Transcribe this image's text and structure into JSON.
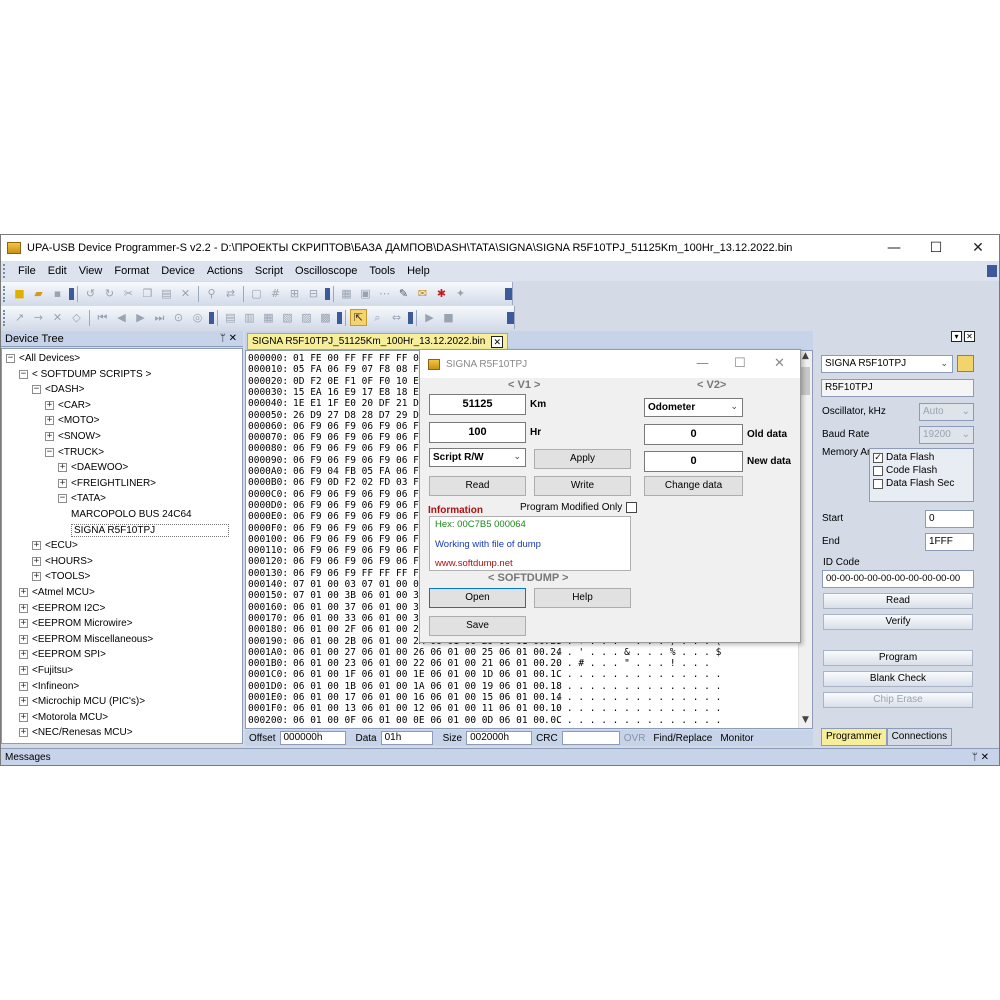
{
  "window": {
    "title": "UPA-USB Device Programmer-S v2.2 - D:\\ПРОЕКТЫ СКРИПТОВ\\БАЗА ДАМПОВ\\DASH\\TATA\\SIGNA\\SIGNA R5F10TPJ_51125Km_100Hr_13.12.2022.bin",
    "minimize": "—",
    "maximize": "☐",
    "close": "✕"
  },
  "menu": [
    "File",
    "Edit",
    "View",
    "Format",
    "Device",
    "Actions",
    "Script",
    "Oscilloscope",
    "Tools",
    "Help"
  ],
  "device_tree": {
    "header": "Device Tree",
    "pin": "ᛘ ✕",
    "items": [
      {
        "label": "<All Devices>",
        "level": 0,
        "exp": "−"
      },
      {
        "label": "< SOFTDUMP SCRIPTS >",
        "level": 1,
        "exp": "−"
      },
      {
        "label": "<DASH>",
        "level": 2,
        "exp": "−"
      },
      {
        "label": "<CAR>",
        "level": 3,
        "exp": "+"
      },
      {
        "label": "<MOTO>",
        "level": 3,
        "exp": "+"
      },
      {
        "label": "<SNOW>",
        "level": 3,
        "exp": "+"
      },
      {
        "label": "<TRUCK>",
        "level": 3,
        "exp": "−"
      },
      {
        "label": "<DAEWOO>",
        "level": 4,
        "exp": "+"
      },
      {
        "label": "<FREIGHTLINER>",
        "level": 4,
        "exp": "+"
      },
      {
        "label": "<TATA>",
        "level": 4,
        "exp": "−"
      },
      {
        "label": "MARCOPOLO BUS 24C64",
        "level": 5,
        "exp": ""
      },
      {
        "label": "SIGNA R5F10TPJ",
        "level": 5,
        "exp": "",
        "selected": true
      },
      {
        "label": "<ECU>",
        "level": 2,
        "exp": "+"
      },
      {
        "label": "<HOURS>",
        "level": 2,
        "exp": "+"
      },
      {
        "label": "<TOOLS>",
        "level": 2,
        "exp": "+"
      },
      {
        "label": "<Atmel MCU>",
        "level": 1,
        "exp": "+"
      },
      {
        "label": "<EEPROM I2C>",
        "level": 1,
        "exp": "+"
      },
      {
        "label": "<EEPROM Microwire>",
        "level": 1,
        "exp": "+"
      },
      {
        "label": "<EEPROM Miscellaneous>",
        "level": 1,
        "exp": "+"
      },
      {
        "label": "<EEPROM SPI>",
        "level": 1,
        "exp": "+"
      },
      {
        "label": "<Fujitsu>",
        "level": 1,
        "exp": "+"
      },
      {
        "label": "<Infineon>",
        "level": 1,
        "exp": "+"
      },
      {
        "label": "<Microchip MCU (PIC's)>",
        "level": 1,
        "exp": "+"
      },
      {
        "label": "<Motorola MCU>",
        "level": 1,
        "exp": "+"
      },
      {
        "label": "<NEC/Renesas MCU>",
        "level": 1,
        "exp": "+"
      }
    ]
  },
  "file_tab": {
    "label": "SIGNA R5F10TPJ_51125Km_100Hr_13.12.2022.bin",
    "close": "✕"
  },
  "hex_rows": [
    {
      "addr": "000000:",
      "bytes": "01 FE 00 FF FF FF FF 0",
      "ascii": ""
    },
    {
      "addr": "000010:",
      "bytes": "05 FA 06 F9 07 F8 08 F7 0",
      "ascii": ""
    },
    {
      "addr": "000020:",
      "bytes": "0D F2 0E F1 0F F0 10 EF 1",
      "ascii": ""
    },
    {
      "addr": "000030:",
      "bytes": "15 EA 16 E9 17 E8 18 E7 1",
      "ascii": ""
    },
    {
      "addr": "000040:",
      "bytes": "1E E1 1F E0 20 DF 21 DE 2",
      "ascii": ""
    },
    {
      "addr": "000050:",
      "bytes": "26 D9 27 D8 28 D7 29 D6 2",
      "ascii": ""
    },
    {
      "addr": "000060:",
      "bytes": "06 F9 06 F9 06 F9 06 F9 0",
      "ascii": ""
    },
    {
      "addr": "000070:",
      "bytes": "06 F9 06 F9 06 F9 06 F9 0",
      "ascii": ""
    },
    {
      "addr": "000080:",
      "bytes": "06 F9 06 F9 06 F9 06 F9 0",
      "ascii": ""
    },
    {
      "addr": "000090:",
      "bytes": "06 F9 06 F9 06 F9 06 F9 0",
      "ascii": ""
    },
    {
      "addr": "0000A0:",
      "bytes": "06 F9 04 FB 05 FA 06 F9 0",
      "ascii": ""
    },
    {
      "addr": "0000B0:",
      "bytes": "06 F9 0D F2 02 FD 03 FC 0",
      "ascii": ""
    },
    {
      "addr": "0000C0:",
      "bytes": "06 F9 06 F9 06 F9 06 F9 0",
      "ascii": ""
    },
    {
      "addr": "0000D0:",
      "bytes": "06 F9 06 F9 06 F9 06 F9 0",
      "ascii": ""
    },
    {
      "addr": "0000E0:",
      "bytes": "06 F9 06 F9 06 F9 06 F9 0",
      "ascii": ""
    },
    {
      "addr": "0000F0:",
      "bytes": "06 F9 06 F9 06 F9 06 F9 0",
      "ascii": ""
    },
    {
      "addr": "000100:",
      "bytes": "06 F9 06 F9 06 F9 06 F9 0",
      "ascii": ""
    },
    {
      "addr": "000110:",
      "bytes": "06 F9 06 F9 06 F9 06 F9 0",
      "ascii": ""
    },
    {
      "addr": "000120:",
      "bytes": "06 F9 06 F9 06 F9 06 F9 0",
      "ascii": ""
    },
    {
      "addr": "000130:",
      "bytes": "06 F9 06 F9 FF FF FF FF F",
      "ascii": ""
    },
    {
      "addr": "000140:",
      "bytes": "07 01 00 03 07 01 00 02 0",
      "ascii": ""
    },
    {
      "addr": "000150:",
      "bytes": "07 01 00 3B 06 01 00 3A 0",
      "ascii": ""
    },
    {
      "addr": "000160:",
      "bytes": "06 01 00 37 06 01 00 36 0",
      "ascii": ""
    },
    {
      "addr": "000170:",
      "bytes": "06 01 00 33 06 01 00 32 0",
      "ascii": ""
    },
    {
      "addr": "000180:",
      "bytes": "06 01 00 2F 06 01 00 2E 0",
      "ascii": ""
    },
    {
      "addr": "000190:",
      "bytes": "06 01 00 2B 06 01 00 2A 06 01 00 29 06 01 00 28",
      "ascii": ". . . + . . . * . . . ) . . . ("
    },
    {
      "addr": "0001A0:",
      "bytes": "06 01 00 27 06 01 00 26 06 01 00 25 06 01 00 24",
      "ascii": ". . . ' . . . & . . . % . . . $"
    },
    {
      "addr": "0001B0:",
      "bytes": "06 01 00 23 06 01 00 22 06 01 00 21 06 01 00 20",
      "ascii": ". . . # . . . \" . . . ! . . ."
    },
    {
      "addr": "0001C0:",
      "bytes": "06 01 00 1F 06 01 00 1E 06 01 00 1D 06 01 00 1C",
      "ascii": ". . . . . . . . . . . . . . . ."
    },
    {
      "addr": "0001D0:",
      "bytes": "06 01 00 1B 06 01 00 1A 06 01 00 19 06 01 00 18",
      "ascii": ". . . . . . . . . . . . . . . ."
    },
    {
      "addr": "0001E0:",
      "bytes": "06 01 00 17 06 01 00 16 06 01 00 15 06 01 00 14",
      "ascii": ". . . . . . . . . . . . . . . ."
    },
    {
      "addr": "0001F0:",
      "bytes": "06 01 00 13 06 01 00 12 06 01 00 11 06 01 00 10",
      "ascii": ". . . . . . . . . . . . . . . ."
    },
    {
      "addr": "000200:",
      "bytes": "06 01 00 0F 06 01 00 0E 06 01 00 0D 06 01 00 0C",
      "ascii": ". . . . . . . . . . . . . . . ."
    }
  ],
  "statusbar": {
    "offset_label": "Offset",
    "offset_value": "000000h",
    "data_label": "Data",
    "data_value": "01h",
    "size_label": "Size",
    "size_value": "002000h",
    "crc_label": "CRC",
    "crc_value": "",
    "ovr": "OVR",
    "find_replace": "Find/Replace",
    "monitor": "Monitor"
  },
  "right_pane": {
    "device_select": "SIGNA R5F10TPJ",
    "device_name": "R5F10TPJ",
    "oscillator_label": "Oscillator, kHz",
    "oscillator_value": "Auto",
    "baud_label": "Baud Rate",
    "baud_value": "19200",
    "memory_label": "Memory Are",
    "memory_options": [
      {
        "label": "Data Flash",
        "checked": "✓"
      },
      {
        "label": "Code Flash",
        "checked": ""
      },
      {
        "label": "Data Flash Sec",
        "checked": ""
      }
    ],
    "start_label": "Start",
    "start_value": "0",
    "end_label": "End",
    "end_value": "1FFF",
    "id_label": "ID Code",
    "id_value": "00-00-00-00-00-00-00-00-00-00",
    "buttons": {
      "read": "Read",
      "verify": "Verify",
      "program": "Program",
      "blank_check": "Blank Check",
      "chip_erase": "Chip Erase"
    },
    "tabs": {
      "programmer": "Programmer",
      "connections": "Connections"
    }
  },
  "messages": {
    "label": "Messages",
    "pin": "ᛘ ✕"
  },
  "dialog": {
    "title": "SIGNA R5F10TPJ",
    "v1": "< V1 >",
    "v2": "< V2>",
    "km_value": "51125",
    "km_label": "Km",
    "hr_value": "100",
    "hr_label": "Hr",
    "script_select": "Script R/W",
    "apply": "Apply",
    "read": "Read",
    "write": "Write",
    "odometer_select": "Odometer",
    "old_value": "0",
    "old_label": "Old data",
    "new_value": "0",
    "new_label": "New data",
    "change_data": "Change data",
    "information_label": "Information",
    "program_modified_label": "Program Modified Only",
    "info_hex": "Hex: 00C7B5  000064",
    "info_working": "Working with file of dump",
    "info_url": "www.softdump.net",
    "softdump": "< SOFTDUMP >",
    "open": "Open",
    "help": "Help",
    "save": "Save"
  },
  "colors": {
    "chrome": "#d4dbe7",
    "panel_header": "#c6d3e8",
    "active_tab": "#f6ee9b",
    "info_red": "#b01010",
    "info_green": "#1a8a1a",
    "info_blue": "#1a3ab0"
  }
}
